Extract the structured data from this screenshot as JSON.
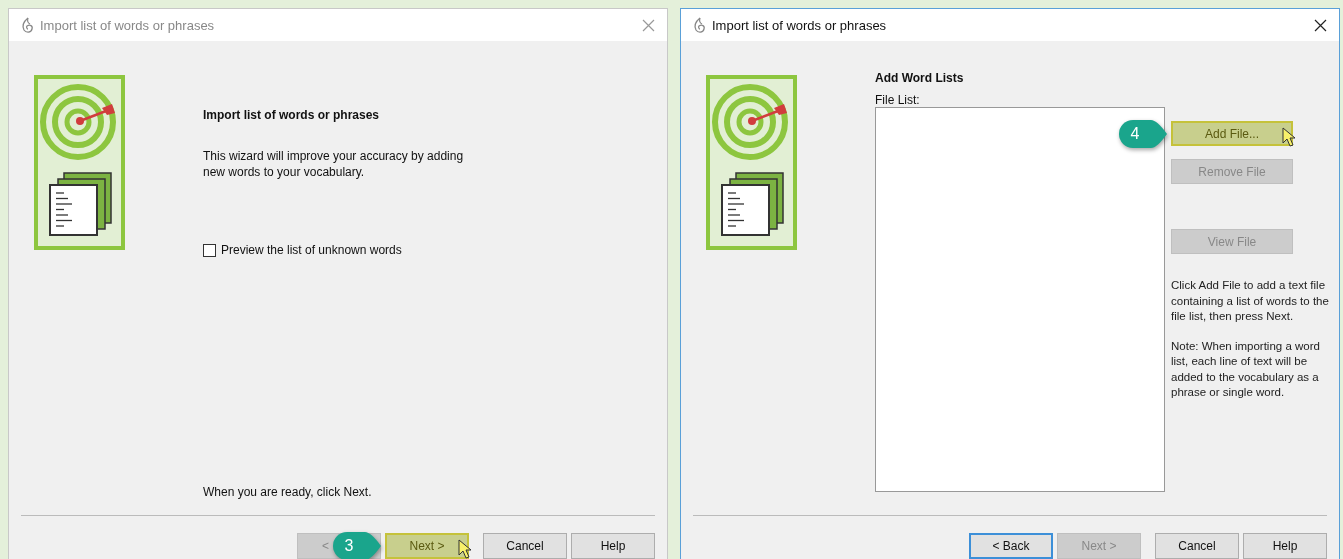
{
  "windows": [
    {
      "title": "Import list of words or phrases",
      "active": false,
      "page": {
        "kind": "intro",
        "heading": "Import list of words or phrases",
        "description": "This wizard will improve your accuracy by adding new words to your vocabulary.",
        "checkbox": {
          "label": "Preview the list of unknown words",
          "checked": false
        },
        "footer_note": "When you are ready, click Next."
      },
      "buttons": [
        {
          "label": "<",
          "disabled": true,
          "focused": false,
          "highlighted": false
        },
        {
          "label": "Next >",
          "disabled": false,
          "focused": true,
          "highlighted": true,
          "callout": "3",
          "cursor": true
        },
        {
          "label": "Cancel",
          "disabled": false,
          "focused": false,
          "highlighted": false
        },
        {
          "label": "Help",
          "disabled": false,
          "focused": false,
          "highlighted": false
        }
      ]
    },
    {
      "title": "Import list of words or phrases",
      "active": true,
      "page": {
        "kind": "file_list",
        "heading": "Add Word Lists",
        "list_label": "File List:",
        "side_buttons": [
          {
            "label": "Add File...",
            "disabled": false,
            "highlighted": true,
            "callout": "4",
            "cursor": true
          },
          {
            "label": "Remove File",
            "disabled": true,
            "highlighted": false
          },
          {
            "label": "View File",
            "disabled": true,
            "highlighted": false
          }
        ],
        "notes": [
          "Click Add File to add a text file containing a list of words to the file list, then press Next.",
          "Note: When importing a word list, each line of text will be added to the vocabulary as a phrase or single word."
        ]
      },
      "buttons": [
        {
          "label": "< Back",
          "disabled": false,
          "focused": true,
          "highlighted": false
        },
        {
          "label": "Next >",
          "disabled": true,
          "focused": false,
          "highlighted": false
        },
        {
          "label": "Cancel",
          "disabled": false,
          "focused": false,
          "highlighted": false
        },
        {
          "label": "Help",
          "disabled": false,
          "focused": false,
          "highlighted": false
        }
      ]
    }
  ]
}
